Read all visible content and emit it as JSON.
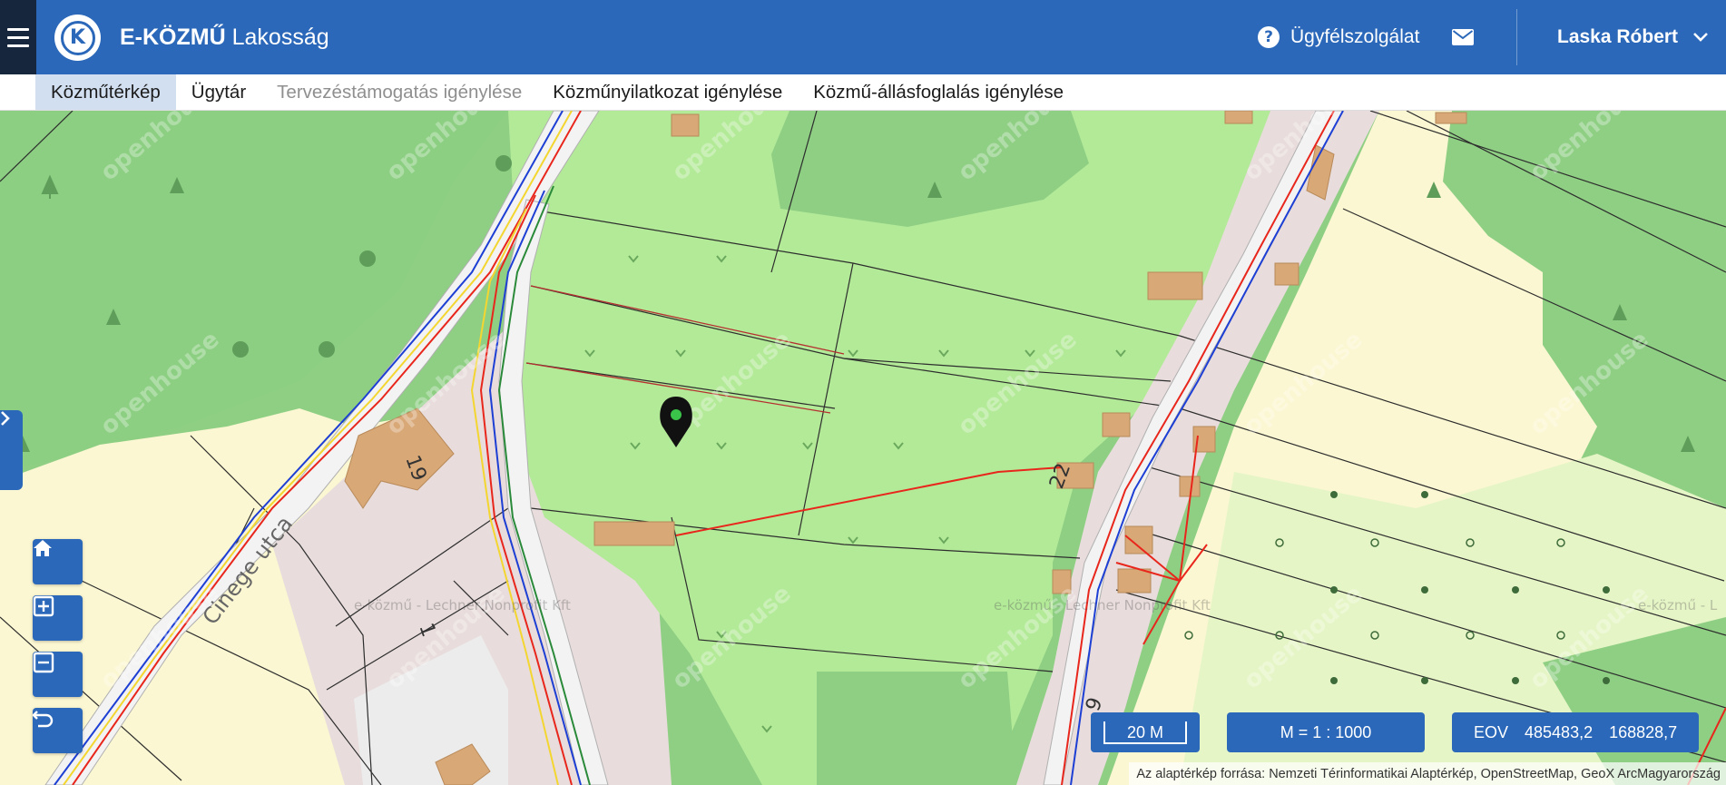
{
  "header": {
    "brand_bold": "E-KÖZMŰ",
    "brand_light": " Lakosság",
    "logo_letter": "K",
    "help_icon_glyph": "?",
    "help_label": "Ügyfélszolgálat",
    "user_name": "Laska Róbert",
    "accent_color": "#2b68b9",
    "icons": [
      "hamburger-icon",
      "help-icon",
      "mail-icon",
      "chevron-down-icon"
    ]
  },
  "nav": {
    "items": [
      {
        "label": "Közműtérkép"
      },
      {
        "label": "Ügytár"
      },
      {
        "label": "Tervezéstámogatás igénylése"
      },
      {
        "label": "Közműnyilatkozat igénylése"
      },
      {
        "label": "Közmű-állásfoglalás igénylése"
      }
    ]
  },
  "map": {
    "labels": {
      "street": "Cinege utca",
      "house_19": "19",
      "house_22": "22",
      "house_1": "1",
      "house_9": "9",
      "provider_1": "e-közmű - Lechner Nonprofit Kft",
      "provider_2": "e-közmű - Lechner Nonprofit Kft",
      "provider_3": "e-közmű - L"
    },
    "watermark": "openhouse",
    "scale_bar": "20 M",
    "scale_ratio": "M = 1 : 1000",
    "coordinate_system": "EOV",
    "coord_x": "485483,2",
    "coord_y": "168828,7",
    "attribution": "Az alaptérkép forrása: Nemzeti Térinformatikai Alaptérkép, OpenStreetMap, GeoX ArcMagyarország"
  },
  "tools": [
    "home-icon",
    "zoom-in-icon",
    "zoom-out-icon",
    "undo-icon"
  ],
  "colors": {
    "forest": "#8fcf84",
    "meadow": "#b3ea98",
    "residential": "#e8dcdc",
    "yellow_zone": "#fbf7d2",
    "orchard": "#e6f5c6",
    "building": "#d9a877",
    "power_line": "#e8261c",
    "water_line": "#1d3fd4",
    "gas_line": "#f3d630"
  }
}
